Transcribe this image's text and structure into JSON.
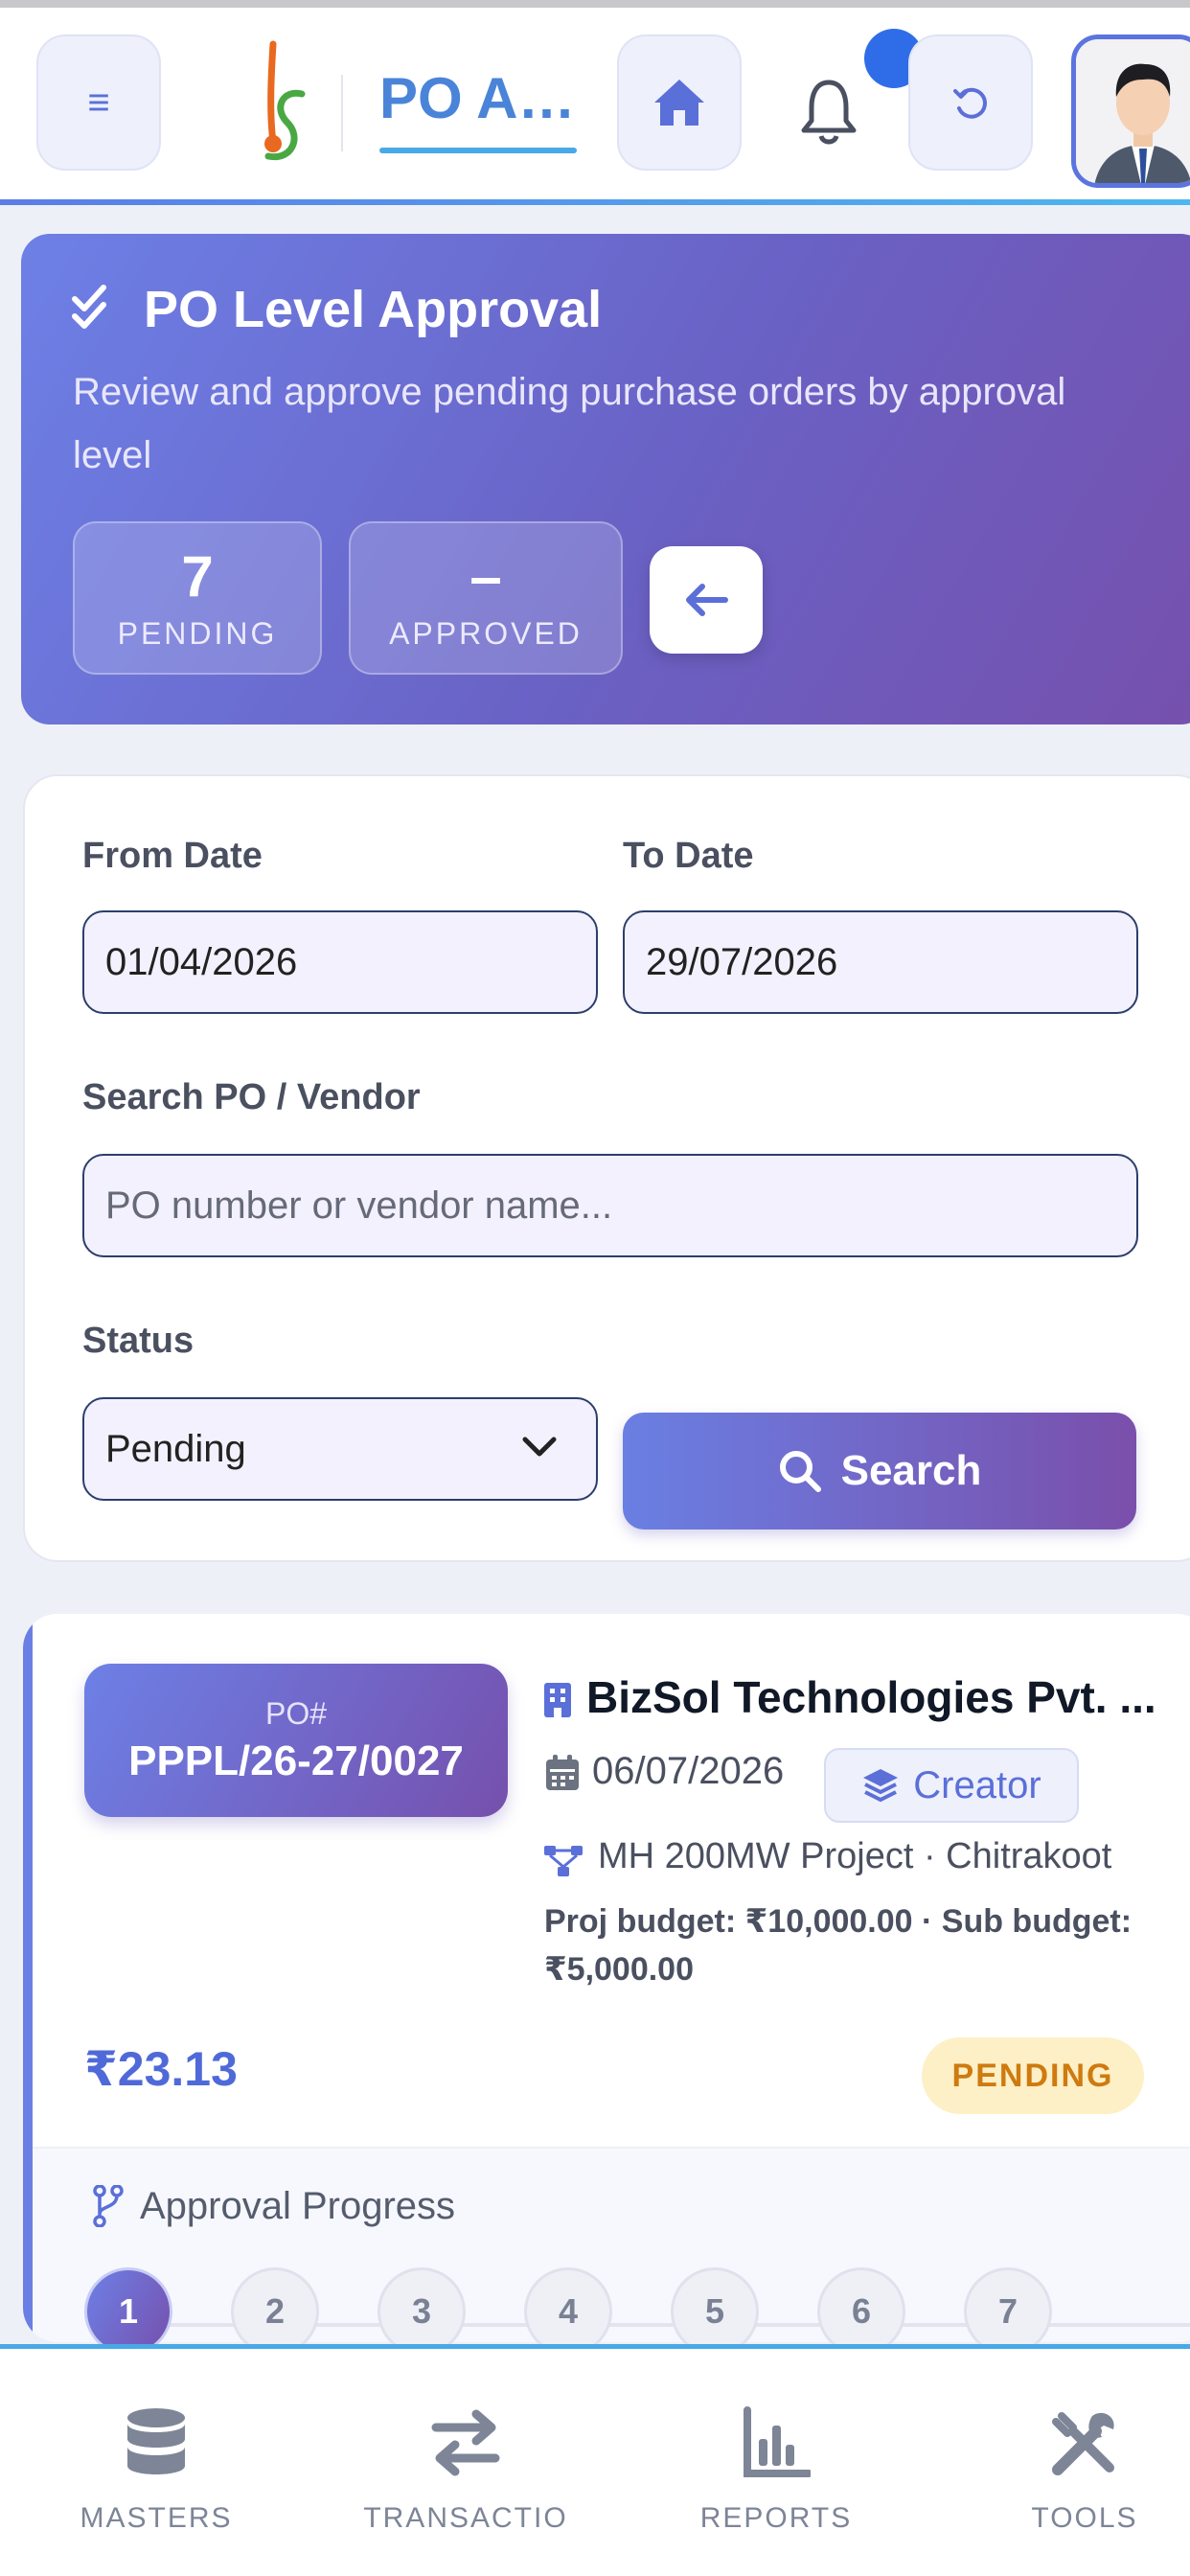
{
  "header": {
    "app_title": "PO A…",
    "icons": [
      "menu-icon",
      "logo",
      "home-icon",
      "bell-icon",
      "refresh-icon",
      "avatar"
    ]
  },
  "hero": {
    "title": "PO Level Approval",
    "subtitle": "Review and approve pending purchase orders by approval level",
    "stats": [
      {
        "value": "7",
        "label": "PENDING"
      },
      {
        "value": "–",
        "label": "APPROVED"
      }
    ]
  },
  "filters": {
    "from_date_label": "From Date",
    "from_date_value": "01/04/2026",
    "to_date_label": "To Date",
    "to_date_value": "29/07/2026",
    "search_label": "Search PO / Vendor",
    "search_placeholder": "PO number or vendor name...",
    "status_label": "Status",
    "status_value": "Pending",
    "search_button": "Search"
  },
  "po_card": {
    "po_label": "PO#",
    "po_number": "PPPL/26-27/0027",
    "vendor": "BizSol Technologies Pvt. ...",
    "date": "06/07/2026",
    "role": "Creator",
    "project": "MH 200MW Project · Chitrakoot",
    "budget": "Proj budget: ₹10,000.00 · Sub budget: ₹5,000.00",
    "amount": "₹23.13",
    "status": "PENDING",
    "progress_label": "Approval Progress",
    "steps": [
      "1",
      "2",
      "3",
      "4",
      "5",
      "6",
      "7"
    ],
    "active_step": 1
  },
  "bottom_nav": [
    {
      "label": "MASTERS",
      "icon": "database-icon"
    },
    {
      "label": "TRANSACTIO",
      "icon": "transfer-icon"
    },
    {
      "label": "REPORTS",
      "icon": "chart-icon"
    },
    {
      "label": "TOOLS",
      "icon": "tools-icon"
    }
  ],
  "colors": {
    "accent": "#6a7fe3",
    "hero_end": "#7650ad",
    "pending_bg": "#fdf0c6",
    "pending_text": "#cf7a10"
  }
}
